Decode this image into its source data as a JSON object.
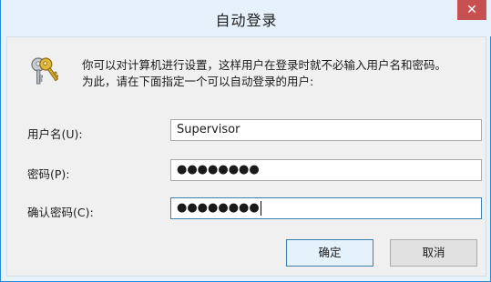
{
  "window": {
    "title": "自动登录",
    "close_label": "✕"
  },
  "description": {
    "line1": "你可以对计算机进行设置，这样用户在登录时就不必输入用户名和密码。",
    "line2": "为此，请在下面指定一个可以自动登录的用户:"
  },
  "fields": {
    "username_label": "用户名(U):",
    "username_value": "Supervisor",
    "password_label": "密码(P):",
    "password_value": "●●●●●●●●",
    "confirm_label": "确认密码(C):",
    "confirm_value": "●●●●●●●●"
  },
  "buttons": {
    "ok_label": "确定",
    "cancel_label": "取消"
  },
  "colors": {
    "close_button": "#c75050",
    "title_bar": "#e7f1fb",
    "window_border": "#2a8ad0",
    "focus_border": "#3c7fb1"
  }
}
